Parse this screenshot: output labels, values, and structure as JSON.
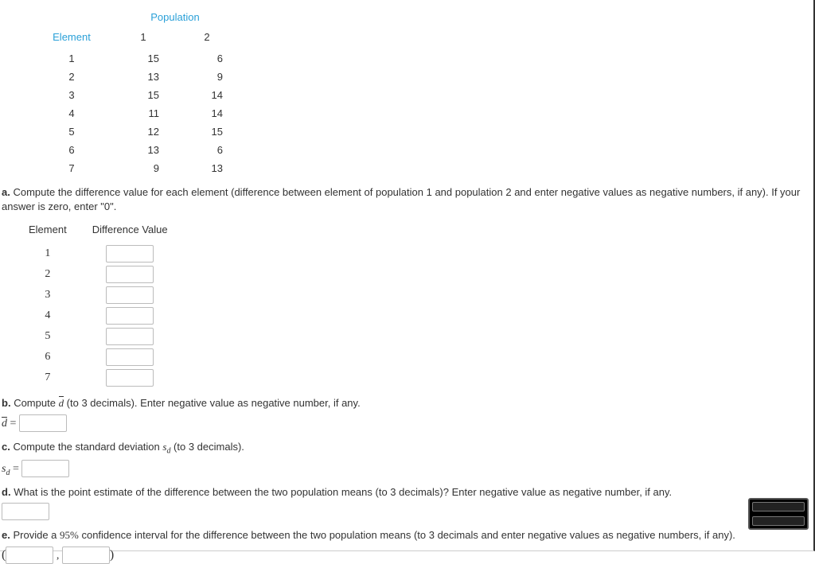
{
  "table": {
    "super_header": "Population",
    "element_header": "Element",
    "pop1_header": "1",
    "pop2_header": "2",
    "rows": [
      {
        "element": "1",
        "p1": "15",
        "p2": "6"
      },
      {
        "element": "2",
        "p1": "13",
        "p2": "9"
      },
      {
        "element": "3",
        "p1": "15",
        "p2": "14"
      },
      {
        "element": "4",
        "p1": "11",
        "p2": "14"
      },
      {
        "element": "5",
        "p1": "12",
        "p2": "15"
      },
      {
        "element": "6",
        "p1": "13",
        "p2": "6"
      },
      {
        "element": "7",
        "p1": "9",
        "p2": "13"
      }
    ]
  },
  "a": {
    "label": "a.",
    "text": "Compute the difference value for each element (difference between element of population 1 and population 2 and enter negative values as negative numbers, if any). If your answer is zero, enter \"0\".",
    "element_header": "Element",
    "diff_header": "Difference Value",
    "rows": [
      "1",
      "2",
      "3",
      "4",
      "5",
      "6",
      "7"
    ]
  },
  "b": {
    "label": "b.",
    "text_before": "Compute ",
    "text_after": " (to 3 decimals). Enter negative value as negative number, if any.",
    "eq": " = "
  },
  "c": {
    "label": "c.",
    "text_before": "Compute the standard deviation ",
    "text_after": " (to 3 decimals).",
    "eq": " = "
  },
  "d": {
    "label": "d.",
    "text": "What is the point estimate of the difference between the two population means (to 3 decimals)? Enter negative value as negative number, if any."
  },
  "e": {
    "label": "e.",
    "text_before": "Provide a ",
    "pct": "95%",
    "text_after": " confidence interval for the difference between the two population means (to 3 decimals and enter negative values as negative numbers, if any).",
    "open": "(",
    "comma": " , ",
    "close": ")"
  }
}
